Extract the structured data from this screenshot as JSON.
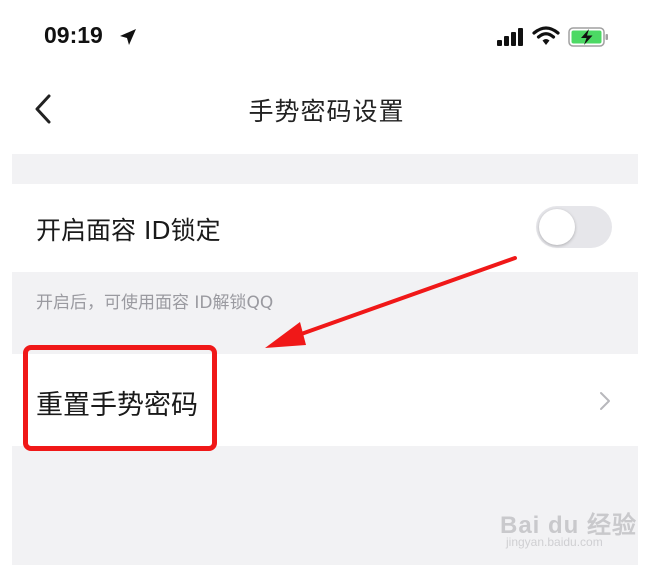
{
  "status_bar": {
    "time": "09:19",
    "icons": [
      "location-arrow-icon",
      "signal-icon",
      "wifi-icon",
      "battery-charging-icon"
    ],
    "battery_color": "#4cd964"
  },
  "nav": {
    "title": "手势密码设置",
    "back_icon": "chevron-left-icon"
  },
  "settings": {
    "faceid_lock": {
      "label": "开启面容 ID锁定",
      "enabled": false,
      "hint": "开启后，可使用面容 ID解锁QQ"
    },
    "reset_gesture": {
      "label": "重置手势密码",
      "icon": "chevron-right-icon"
    }
  },
  "annotation": {
    "highlight_color": "#f01818"
  },
  "watermark": {
    "text": "Bai du 经验",
    "sub": "jingyan.baidu.com"
  }
}
